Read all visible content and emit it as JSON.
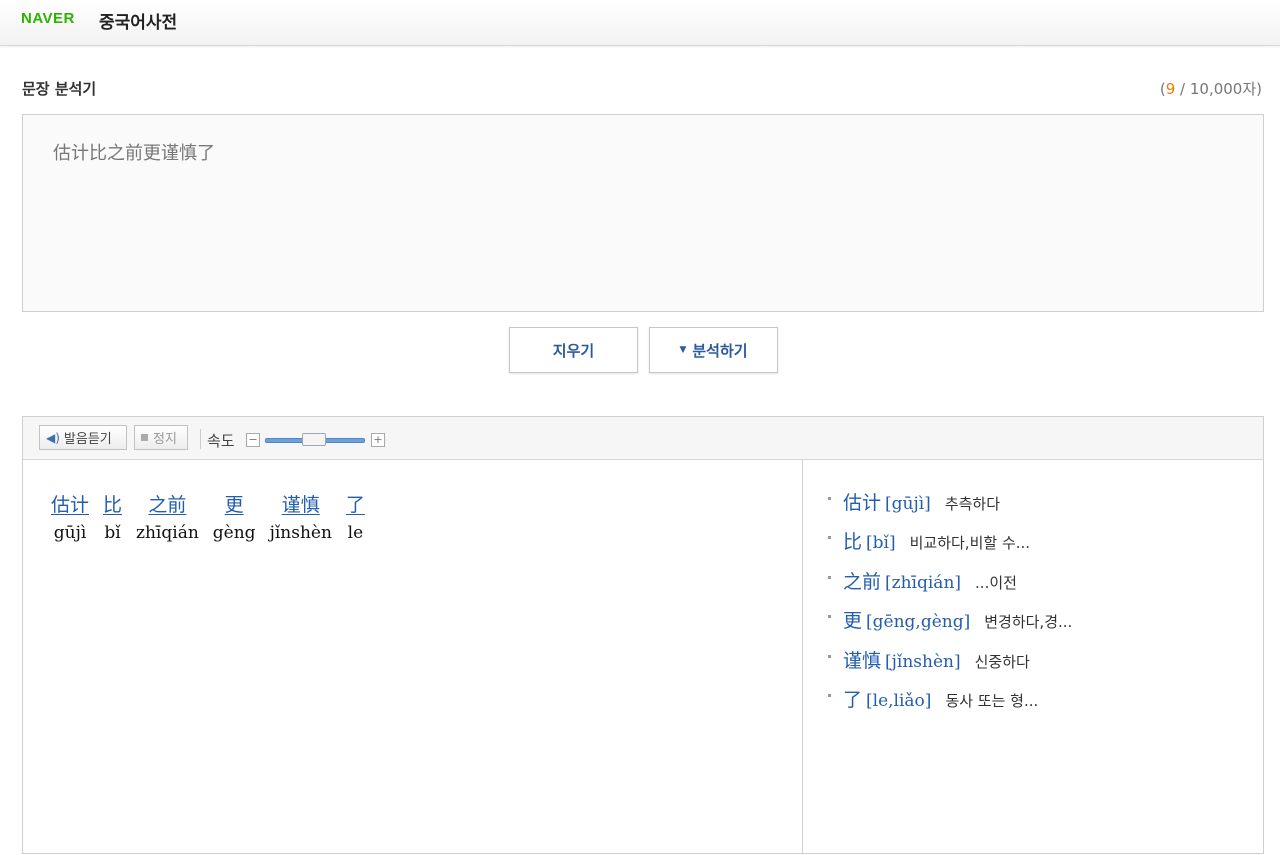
{
  "header": {
    "logo": "NAVER",
    "title": "중국어사전"
  },
  "analyzer": {
    "title": "문장 분석기",
    "count_open": "(",
    "count_current": "9",
    "count_rest": " / 10,000자)",
    "input_text": "估计比之前更谨慎了",
    "clear_label": "지우기",
    "analyze_label": "분석하기"
  },
  "toolbar": {
    "listen_label": "발음듣기",
    "stop_label": "정지",
    "speed_label": "속도",
    "minus": "−",
    "plus": "+"
  },
  "words": [
    {
      "hanzi": "估计",
      "pinyin": "gūjì"
    },
    {
      "hanzi": "比",
      "pinyin": "bǐ"
    },
    {
      "hanzi": "之前",
      "pinyin": "zhīqián"
    },
    {
      "hanzi": "更",
      "pinyin": "gèng"
    },
    {
      "hanzi": "谨慎",
      "pinyin": "jǐnshèn"
    },
    {
      "hanzi": "了",
      "pinyin": "le"
    }
  ],
  "definitions": [
    {
      "hanzi": "估计",
      "pinyin": "[gūjì]",
      "meaning": "추측하다"
    },
    {
      "hanzi": "比",
      "pinyin": "[bǐ]",
      "meaning": "비교하다,비할 수..."
    },
    {
      "hanzi": "之前",
      "pinyin": "[zhīqián]",
      "meaning": "...이전"
    },
    {
      "hanzi": "更",
      "pinyin": "[gēng,gèng]",
      "meaning": "변경하다,경..."
    },
    {
      "hanzi": "谨慎",
      "pinyin": "[jǐnshèn]",
      "meaning": "신중하다"
    },
    {
      "hanzi": "了",
      "pinyin": "[le,liǎo]",
      "meaning": "동사 또는 형..."
    }
  ],
  "colors": {
    "brand": "#2db400",
    "link": "#235db0",
    "count_highlight": "#e67e00"
  }
}
